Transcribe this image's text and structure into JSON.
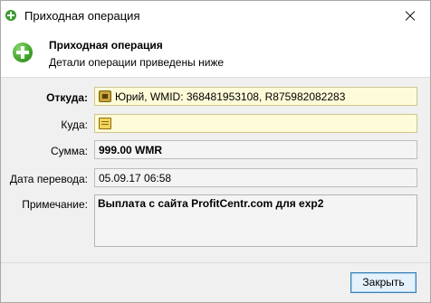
{
  "window": {
    "title": "Приходная операция",
    "close_icon": "close-icon",
    "app_icon": "plus-circle-icon"
  },
  "header": {
    "title": "Приходная операция",
    "subtitle": "Детали операции приведены ниже",
    "icon": "plus-circle-icon"
  },
  "form": {
    "from_label": "Откуда:",
    "from_value": "Юрий, WMID: 368481953108, R875982082283",
    "to_label": "Куда:",
    "to_value": "",
    "amount_label": "Сумма:",
    "amount_value": "999.00 WMR",
    "date_label": "Дата перевода:",
    "date_value": "05.09.17 06:58",
    "note_label": "Примечание:",
    "note_value": "Выплата с сайта ProfitCentr.com для exp2"
  },
  "footer": {
    "close_button": "Закрыть"
  },
  "colors": {
    "accent_green": "#3ea32a",
    "field_yellow": "#fefbd8",
    "button_blue": "#3c7fb1"
  }
}
